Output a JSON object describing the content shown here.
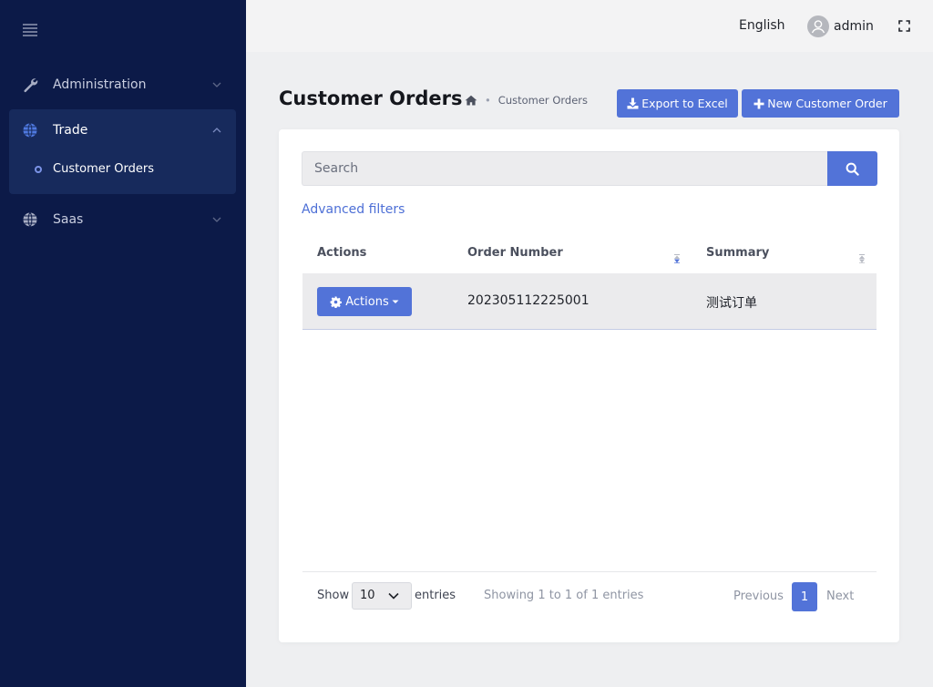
{
  "sidebar": {
    "menu_icon": "hamburger-icon",
    "items": [
      {
        "label": "Administration",
        "icon": "wrench-icon",
        "expanded": false
      },
      {
        "label": "Trade",
        "icon": "globe-icon",
        "expanded": true,
        "children": [
          {
            "label": "Customer Orders",
            "active": true
          }
        ]
      },
      {
        "label": "Saas",
        "icon": "globe-icon",
        "expanded": false
      }
    ]
  },
  "topbar": {
    "language": "English",
    "username": "admin",
    "fullscreen_icon": "fullscreen-icon"
  },
  "page": {
    "title": "Customer Orders",
    "breadcrumb": {
      "home_icon": "home-icon",
      "current": "Customer Orders"
    },
    "buttons": {
      "export": "Export to Excel",
      "new_order": "New Customer Order"
    }
  },
  "filters": {
    "search_placeholder": "Search",
    "search_value": "",
    "advanced_filters": "Advanced filters"
  },
  "table": {
    "columns": [
      "Actions",
      "Order Number",
      "Summary"
    ],
    "sorted_column": "Order Number",
    "rows": [
      {
        "action_label": "Actions",
        "order_number": "202305112225001",
        "summary": "测试订单"
      }
    ]
  },
  "pagination": {
    "show_label": "Show",
    "page_size": "10",
    "entries_label": "entries",
    "info": "Showing 1 to 1 of 1 entries",
    "previous": "Previous",
    "current_page": "1",
    "next": "Next"
  },
  "colors": {
    "sidebar_bg": "#0c1a48",
    "sidebar_active_bg": "#172a5c",
    "primary": "#5273d8",
    "link": "#4d6fd6"
  }
}
